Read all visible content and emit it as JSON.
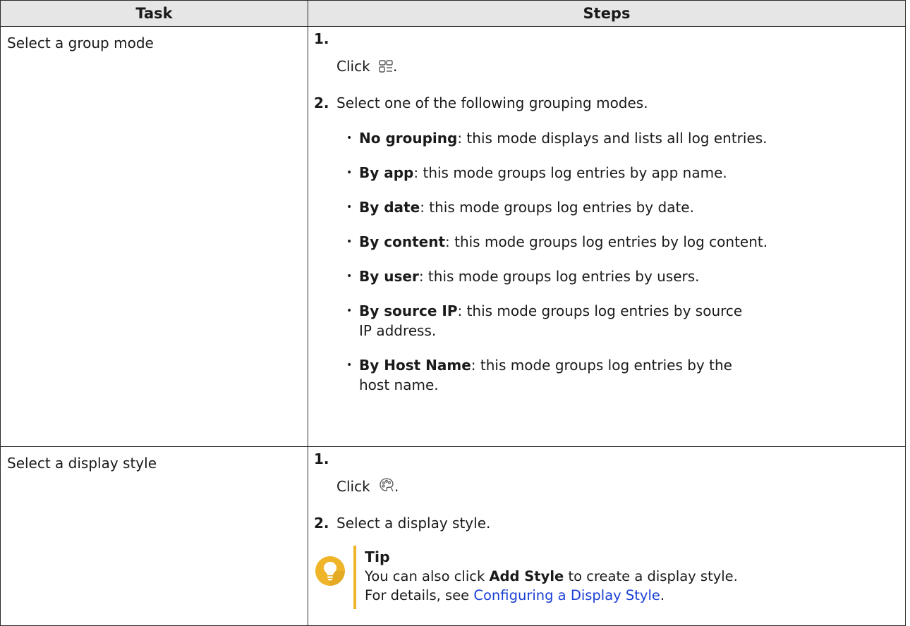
{
  "table": {
    "headers": {
      "task": "Task",
      "steps": "Steps"
    },
    "rows": [
      {
        "task": "Select a group mode",
        "steps": {
          "s1_num": "1.",
          "s1_text": "Click",
          "s1_after": ".",
          "s1_icon": "group-mode-icon",
          "s2_num": "2.",
          "s2_text": "Select one of the following grouping modes.",
          "modes": [
            {
              "name": "No grouping",
              "desc": ": this mode displays and lists all log entries."
            },
            {
              "name": "By app",
              "desc": ": this mode groups log entries by app name."
            },
            {
              "name": "By date",
              "desc": ": this mode groups log entries by date."
            },
            {
              "name": "By content",
              "desc": ": this mode groups log entries by log content."
            },
            {
              "name": "By user",
              "desc": ": this mode groups log entries by users."
            },
            {
              "name": "By source IP",
              "desc": ": this mode groups log entries by source IP address."
            },
            {
              "name": "By Host Name",
              "desc": ": this mode groups log entries by the host name."
            }
          ]
        }
      },
      {
        "task": "Select a display style",
        "steps": {
          "s1_num": "1.",
          "s1_text": "Click",
          "s1_after": ".",
          "s1_icon": "palette-icon",
          "s2_num": "2.",
          "s2_text": "Select a display style.",
          "tip": {
            "icon": "lightbulb-icon",
            "title": "Tip",
            "line1_pre": "You can also click ",
            "line1_bold": "Add Style",
            "line1_post": " to create a display style.",
            "line2_pre": "For details, see ",
            "line2_link": "Configuring a Display Style",
            "line2_post": "."
          }
        }
      }
    ]
  },
  "colors": {
    "header_bg": "#e6e6e6",
    "border": "#2b2b2b",
    "tip_accent": "#f0b429",
    "link": "#1a3fd6"
  }
}
